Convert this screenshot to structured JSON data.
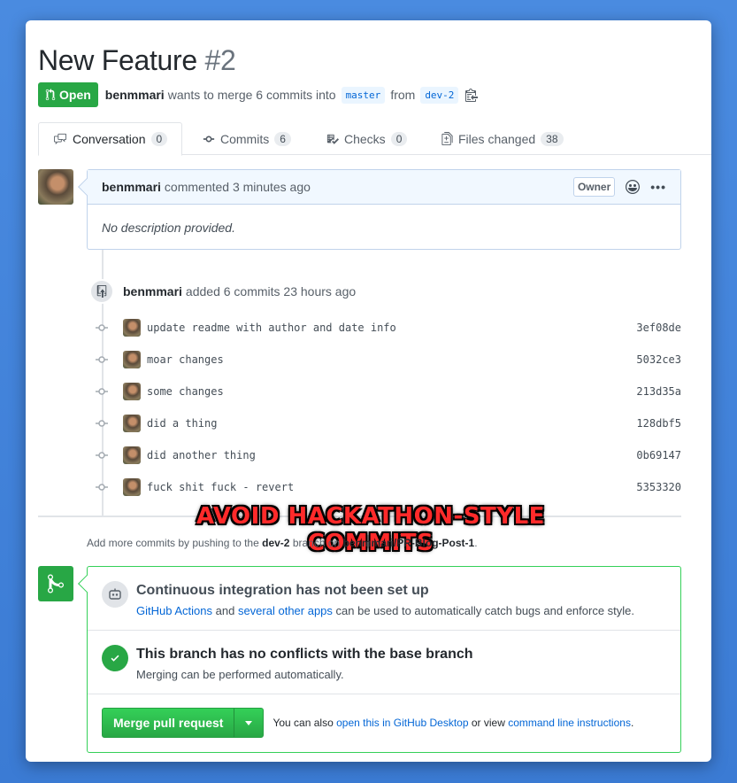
{
  "pr": {
    "title": "New Feature",
    "number": "#2",
    "state": "Open",
    "author": "benmmari",
    "merge_text": "wants to merge 6 commits into",
    "base_branch": "master",
    "from_text": "from",
    "head_branch": "dev-2"
  },
  "tabs": [
    {
      "label": "Conversation",
      "count": "0",
      "icon": "comment-icon"
    },
    {
      "label": "Commits",
      "count": "6",
      "icon": "commit-icon"
    },
    {
      "label": "Checks",
      "count": "0",
      "icon": "checklist-icon"
    },
    {
      "label": "Files changed",
      "count": "38",
      "icon": "file-diff-icon"
    }
  ],
  "comment": {
    "author": "benmmari",
    "action": "commented 3 minutes ago",
    "badge": "Owner",
    "body": "No description provided."
  },
  "event": {
    "author": "benmmari",
    "action": "added 6 commits 23 hours ago"
  },
  "commits": [
    {
      "message": "update readme with author and date info",
      "sha": "3ef08de"
    },
    {
      "message": "moar changes",
      "sha": "5032ce3"
    },
    {
      "message": "some changes",
      "sha": "213d35a"
    },
    {
      "message": "did a thing",
      "sha": "128dbf5"
    },
    {
      "message": "did another thing",
      "sha": "0b69147"
    },
    {
      "message": "fuck shit fuck - revert",
      "sha": "5353320"
    }
  ],
  "overlay_caption": "AVOID HACKATHON-STYLE COMMITS",
  "push_note": {
    "prefix": "Add more commits by pushing to the",
    "branch": "dev-2",
    "middle": "branch on",
    "repo": "benmmari/PR-Blog-Post-1",
    "suffix": "."
  },
  "merge": {
    "ci_title": "Continuous integration has not been set up",
    "ci_link1": "GitHub Actions",
    "ci_and": "and",
    "ci_link2": "several other apps",
    "ci_rest": "can be used to automatically catch bugs and enforce style.",
    "conflict_title": "This branch has no conflicts with the base branch",
    "conflict_sub": "Merging can be performed automatically.",
    "button": "Merge pull request",
    "foot_prefix": "You can also",
    "foot_link1": "open this in GitHub Desktop",
    "foot_mid": "or view",
    "foot_link2": "command line instructions",
    "foot_end": "."
  },
  "colors": {
    "green": "#28a745",
    "link": "#0366d6",
    "overlay_red": "#ff2a2a"
  }
}
